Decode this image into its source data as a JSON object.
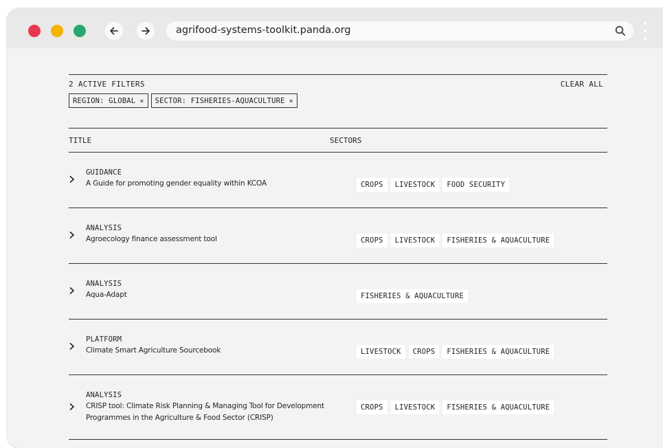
{
  "browser": {
    "url": "agrifood-systems-toolkit.panda.org",
    "colors": {
      "close": "#e8384f",
      "minimize": "#f5b300",
      "maximize": "#25a86e"
    }
  },
  "filters": {
    "label": "2 ACTIVE FILTERS",
    "clear_all": "CLEAR ALL",
    "chips": [
      {
        "label": "REGION: GLOBAL",
        "remove": "×"
      },
      {
        "label": "SECTOR: FISHERIES-AQUACULTURE",
        "remove": "×"
      }
    ]
  },
  "table": {
    "columns": {
      "title": "TITLE",
      "sectors": "SECTORS"
    },
    "rows": [
      {
        "type": "GUIDANCE",
        "title": "A Guide for promoting gender equality within KCOA",
        "title2": "",
        "sectors": [
          "CROPS",
          "LIVESTOCK",
          "FOOD SECURITY"
        ]
      },
      {
        "type": "ANALYSIS",
        "title": "Agroecology finance assessment tool",
        "title2": "",
        "sectors": [
          "CROPS",
          "LIVESTOCK",
          "FISHERIES & AQUACULTURE"
        ]
      },
      {
        "type": "ANALYSIS",
        "title": "Aqua-Adapt",
        "title2": "",
        "sectors": [
          "FISHERIES & AQUACULTURE"
        ]
      },
      {
        "type": "PLATFORM",
        "title": "Climate Smart Agriculture Sourcebook",
        "title2": "",
        "sectors": [
          "LIVESTOCK",
          "CROPS",
          "FISHERIES & AQUACULTURE"
        ]
      },
      {
        "type": "ANALYSIS",
        "title": "CRISP tool: Climate Risk Planning & Managing Tool for Development",
        "title2": "Programmes in the Agriculture & Food Sector (CRISP)",
        "sectors": [
          "CROPS",
          "LIVESTOCK",
          "FISHERIES & AQUACULTURE"
        ]
      }
    ]
  }
}
